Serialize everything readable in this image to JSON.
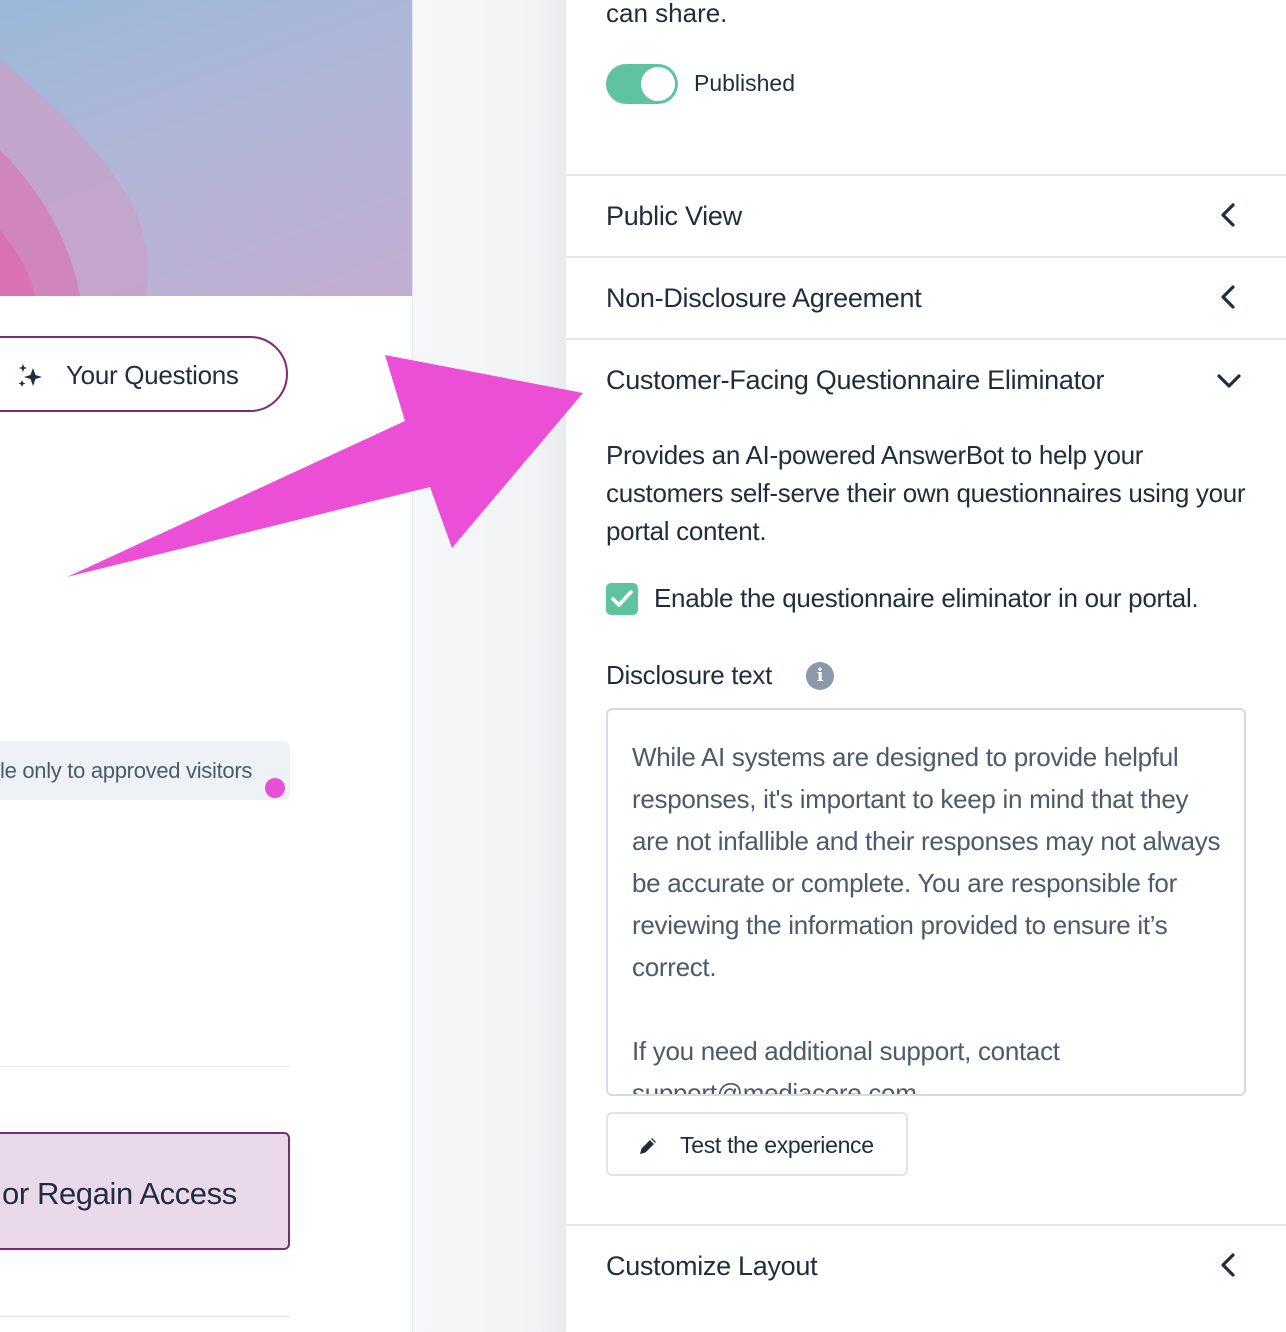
{
  "left_preview": {
    "questions_button_label": "Your Questions",
    "visitors_text": "le only to approved visitors",
    "regain_access_label": "or Regain Access"
  },
  "settings_panel": {
    "share_text": "can share.",
    "publish_toggle": {
      "label": "Published",
      "on": true
    },
    "sections": {
      "public_view": "Public View",
      "nda": "Non-Disclosure Agreement",
      "questionnaire_eliminator": "Customer-Facing Questionnaire Eliminator",
      "customize_layout": "Customize Layout"
    },
    "eliminator": {
      "description": "Provides an AI-powered AnswerBot to help your customers self-serve their own questionnaires using your portal content.",
      "enable_checkbox_label": "Enable the questionnaire eliminator in our portal.",
      "enable_checked": true,
      "disclosure_label": "Disclosure text",
      "disclosure_text": "While AI systems are designed to provide helpful responses, it's important to keep in mind that they are not infallible and their responses may not always be accurate or complete. You are responsible for reviewing the information provided to ensure it’s correct.\n\nIf you need additional support, contact support@mediacore.com",
      "test_button_label": "Test the experience"
    }
  },
  "colors": {
    "accent_green": "#5fc3a0",
    "brand_purple": "#7a2a7a",
    "annotation_pink": "#e84fd6"
  }
}
